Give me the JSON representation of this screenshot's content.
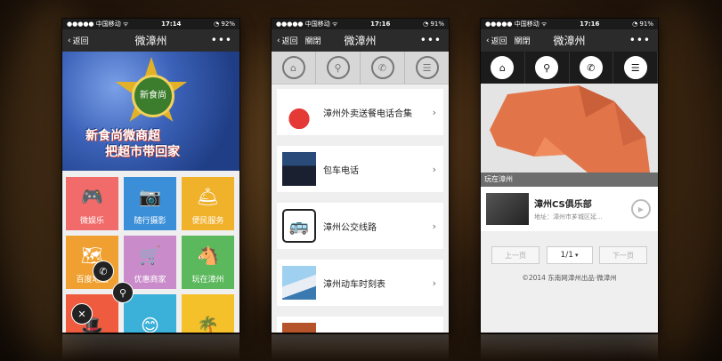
{
  "phone1": {
    "status": {
      "carrier": "●●●●● 中国移动 ᯤ",
      "time": "17:14",
      "battery": "◔ 92%"
    },
    "titlebar": {
      "back": "返回",
      "title": "微漳州",
      "more": "•••"
    },
    "banner": {
      "badge": "新食尚",
      "line1": "新食尚微商超",
      "line2": "把超市带回家"
    },
    "tiles": [
      {
        "label": "微娱乐",
        "color": "#f26b6b",
        "icon": "gamepad-icon"
      },
      {
        "label": "随行摄影",
        "color": "#3b8fd8",
        "icon": "camera-icon"
      },
      {
        "label": "便民服务",
        "color": "#f0b12b",
        "icon": "service-bell-icon"
      },
      {
        "label": "百度地图",
        "color": "#f0a030",
        "icon": "map-icon"
      },
      {
        "label": "优惠商家",
        "color": "#c98bc9",
        "icon": "shopping-cart-icon"
      },
      {
        "label": "玩在漳州",
        "color": "#5cb85c",
        "icon": "horse-icon"
      },
      {
        "label": "",
        "color": "#ef5b3f",
        "icon": "hat-icon"
      },
      {
        "label": "",
        "color": "#3bb0d8",
        "icon": "smiley-icon"
      },
      {
        "label": "",
        "color": "#f5c12b",
        "icon": "plant-icon"
      }
    ]
  },
  "phone2": {
    "status": {
      "carrier": "●●●●● 中国移动 ᯤ",
      "time": "17:16",
      "battery": "◔ 91%"
    },
    "titlebar": {
      "back": "返回",
      "close": "關閉",
      "title": "微漳州",
      "more": "•••"
    },
    "items": [
      {
        "label": "漳州外卖送餐电话合集"
      },
      {
        "label": "包车电话"
      },
      {
        "label": "漳州公交线路"
      },
      {
        "label": "漳州动车时刻表"
      }
    ]
  },
  "phone3": {
    "status": {
      "carrier": "●●●●● 中国移动 ᯤ",
      "time": "17:16",
      "battery": "◔ 91%"
    },
    "titlebar": {
      "back": "返回",
      "close": "關閉",
      "title": "微漳州",
      "more": "•••"
    },
    "section": "玩在漳州",
    "club": {
      "name": "漳州CS俱乐部",
      "address": "地址：漳州市芗城区延..."
    },
    "pager": {
      "prev": "上一页",
      "current": "1/1",
      "next": "下一页"
    },
    "footer": "©2014 东南网漳州出品·微漳州"
  }
}
